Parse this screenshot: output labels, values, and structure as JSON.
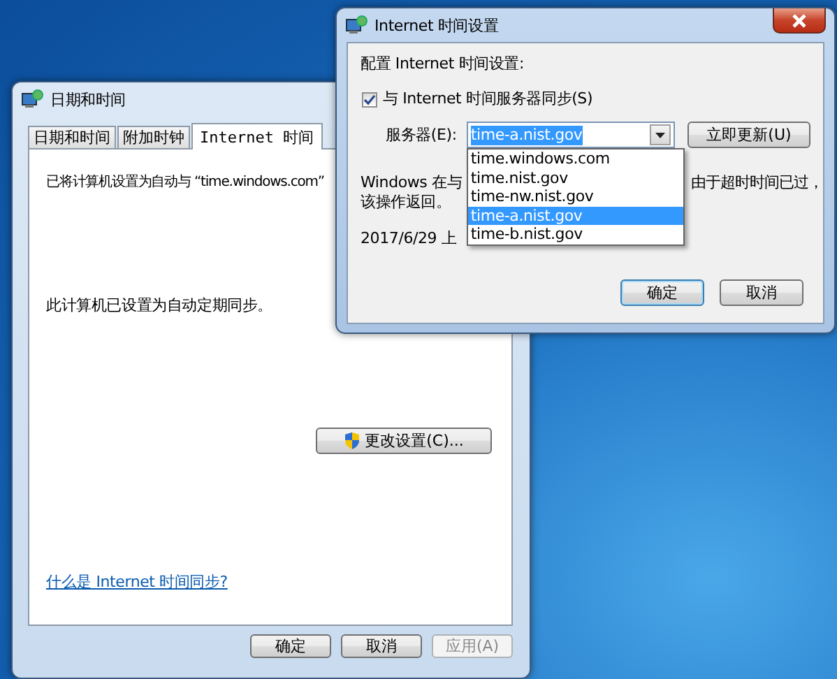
{
  "date_time_window": {
    "title": "日期和时间",
    "active": false,
    "tabs": [
      {
        "label": "日期和时间",
        "selected": false
      },
      {
        "label": "附加时钟",
        "selected": false
      },
      {
        "label": "Internet 时间",
        "selected": true
      }
    ],
    "sync_text": "已将计算机设置为自动与 “time.windows.com”",
    "status_text": "此计算机已设置为自动定期同步。",
    "change_button": "更改设置(C)...",
    "help_link": "什么是 Internet 时间同步?",
    "buttons": [
      {
        "label": "确定",
        "disabled": false
      },
      {
        "label": "取消",
        "disabled": false
      },
      {
        "label": "应用(A)",
        "disabled": true
      }
    ]
  },
  "internet_time_dialog": {
    "title": "Internet 时间设置",
    "active": true,
    "heading": "配置 Internet 时间设置:",
    "sync_checkbox": {
      "label": "与 Internet 时间服务器同步(S)",
      "checked": true
    },
    "server_label": "服务器(E):",
    "server_value": "time-a.nist.gov",
    "server_options": [
      {
        "label": "time.windows.com",
        "selected": false
      },
      {
        "label": "time.nist.gov",
        "selected": false
      },
      {
        "label": "time-nw.nist.gov",
        "selected": false
      },
      {
        "label": "time-a.nist.gov",
        "selected": true
      },
      {
        "label": "time-b.nist.gov",
        "selected": false
      }
    ],
    "update_button": "立即更新(U)",
    "message_line_1_left": "Windows 在与",
    "message_line_1_right": "由于超时时间已过，",
    "message_line_2": "该操作返回。",
    "date_line": "2017/6/29 上",
    "buttons": [
      {
        "label": "确定",
        "focused": true
      },
      {
        "label": "取消",
        "focused": false
      }
    ]
  }
}
